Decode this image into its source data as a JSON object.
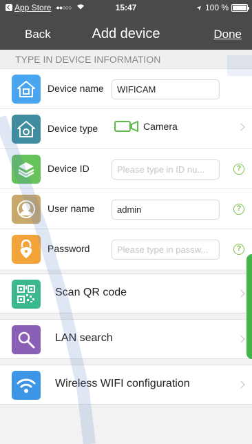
{
  "status_bar": {
    "carrier": "App Store",
    "signal": "●●○○○",
    "time": "15:47",
    "location_arrow": "➤",
    "battery": "100 %",
    "battery_level": 1.0
  },
  "nav": {
    "back": "Back",
    "title": "Add device",
    "done": "Done"
  },
  "section_header": "TYPE IN DEVICE INFORMATION",
  "form": {
    "device_name": {
      "label": "Device name",
      "value": "WIFICAM",
      "icon": "home-icon",
      "color": "#4aa5f0"
    },
    "device_type": {
      "label": "Device type",
      "value": "Camera",
      "icon": "house-camera-icon",
      "color": "#3f8c9e"
    },
    "device_id": {
      "label": "Device ID",
      "value": "",
      "placeholder": "Please type in ID nu...",
      "icon": "layers-icon",
      "color": "#66c25b",
      "help": "?"
    },
    "user_name": {
      "label": "User name",
      "value": "admin",
      "icon": "user-icon",
      "color": "#c8a86b",
      "help": "?"
    },
    "password": {
      "label": "Password",
      "value": "",
      "placeholder": "Please type in passw...",
      "icon": "lock-icon",
      "color": "#f2a33a",
      "help": "?"
    }
  },
  "actions": {
    "scan_qr": {
      "label": "Scan QR code",
      "icon": "qr-code-icon",
      "color": "#3bb98c"
    },
    "lan_search": {
      "label": "LAN search",
      "icon": "search-icon",
      "color": "#8a5fb8"
    },
    "wireless_wifi": {
      "label": "Wireless WIFI configuration",
      "icon": "wifi-icon",
      "color": "#3d95e6"
    }
  },
  "colors": {
    "navbar": "#4a4a4a",
    "help": "#79c04a",
    "green_tab": "#44b649"
  }
}
